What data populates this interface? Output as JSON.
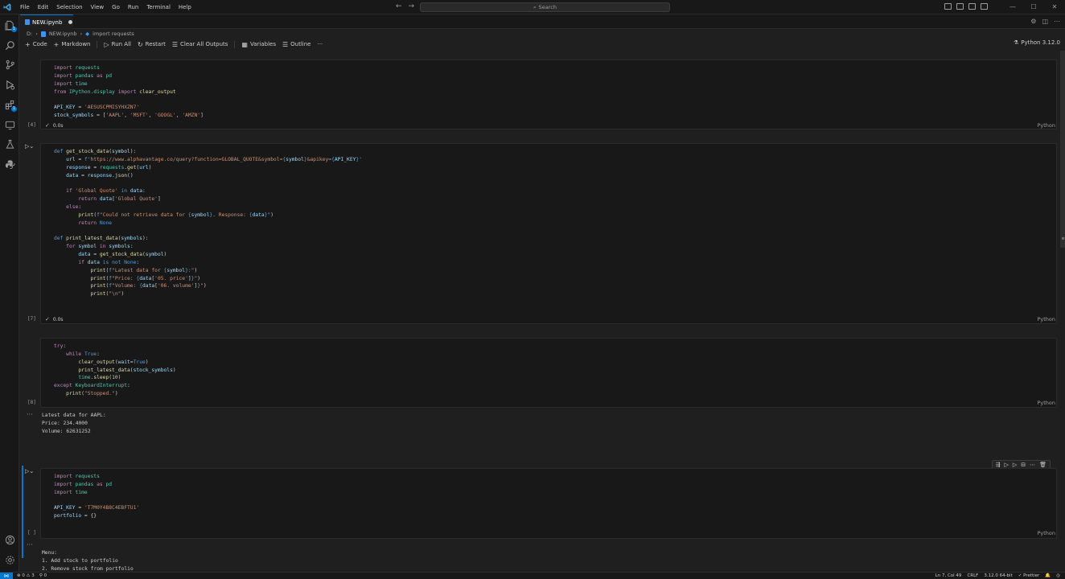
{
  "menu": [
    "File",
    "Edit",
    "Selection",
    "View",
    "Go",
    "Run",
    "Terminal",
    "Help"
  ],
  "search": {
    "label": "Search"
  },
  "tab": {
    "title": "NEW.ipynb"
  },
  "breadcrumb": {
    "drive": "D:",
    "file": "NEW.ipynb",
    "symbol": "import requests"
  },
  "toolbar": {
    "code": "Code",
    "markdown": "Markdown",
    "run_all": "Run All",
    "restart": "Restart",
    "clear_outputs": "Clear All Outputs",
    "variables": "Variables",
    "outline": "Outline",
    "more": "···"
  },
  "kernel": {
    "label": "Python 3.12.0"
  },
  "cells": [
    {
      "exec": "[4]",
      "time": "0.0s",
      "lang": "Python"
    },
    {
      "exec": "[7]",
      "time": "0.0s",
      "lang": "Python"
    },
    {
      "exec": "[8]",
      "lang": "Python",
      "output": [
        "Latest data for AAPL:",
        "Price: 234.4000",
        "Volume: 62631252"
      ]
    },
    {
      "exec": "[ ]",
      "lang": "Python",
      "output": [
        "Menu:",
        "1. Add stock to portfolio",
        "2. Remove stock from portfolio"
      ]
    }
  ],
  "statusbar": {
    "problems": "⊗ 0 ⚠ 3",
    "ports": "⚲ 0",
    "position": "Ln 7, Col 49",
    "eol": "CRLF",
    "interpreter": "3.12.0 64-bit",
    "prettier": "✓ Prettier"
  }
}
